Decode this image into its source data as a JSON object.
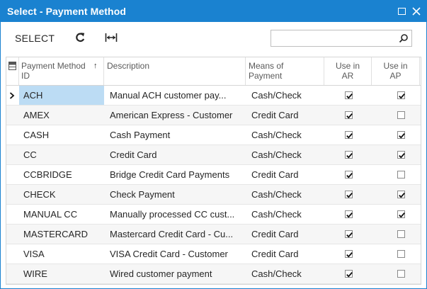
{
  "window": {
    "title": "Select - Payment Method"
  },
  "toolbar": {
    "select_label": "SELECT",
    "refresh_icon": "refresh-icon",
    "fit_icon": "fit-columns-icon"
  },
  "search": {
    "value": "",
    "placeholder": "",
    "icon": "search-icon"
  },
  "grid": {
    "headers": {
      "id": "Payment Method ID",
      "description": "Description",
      "means": "Means of Payment",
      "use_ar": "Use in AR",
      "use_ap": "Use in AP"
    },
    "sort": {
      "column": "id",
      "direction": "asc"
    },
    "rows": [
      {
        "id": "ACH",
        "description": "Manual ACH customer pay...",
        "means": "Cash/Check",
        "use_ar": true,
        "use_ap": true,
        "current": true
      },
      {
        "id": "AMEX",
        "description": "American Express - Customer",
        "means": "Credit Card",
        "use_ar": true,
        "use_ap": false
      },
      {
        "id": "CASH",
        "description": "Cash Payment",
        "means": "Cash/Check",
        "use_ar": true,
        "use_ap": true
      },
      {
        "id": "CC",
        "description": "Credit Card",
        "means": "Cash/Check",
        "use_ar": true,
        "use_ap": true
      },
      {
        "id": "CCBRIDGE",
        "description": "Bridge Credit Card Payments",
        "means": "Credit Card",
        "use_ar": true,
        "use_ap": false
      },
      {
        "id": "CHECK",
        "description": "Check Payment",
        "means": "Cash/Check",
        "use_ar": true,
        "use_ap": true
      },
      {
        "id": "MANUAL CC",
        "description": "Manually processed CC cust...",
        "means": "Cash/Check",
        "use_ar": true,
        "use_ap": true
      },
      {
        "id": "MASTERCARD",
        "description": "Mastercard Credit Card - Cu...",
        "means": "Credit Card",
        "use_ar": true,
        "use_ap": false
      },
      {
        "id": "VISA",
        "description": "VISA Credit Card - Customer",
        "means": "Credit Card",
        "use_ar": true,
        "use_ap": false
      },
      {
        "id": "WIRE",
        "description": "Wired customer payment",
        "means": "Cash/Check",
        "use_ar": true,
        "use_ap": false
      }
    ]
  },
  "colors": {
    "titlebar": "#1a82d0",
    "selected_cell": "#bcdcf4",
    "row_alt": "#f6f6f6"
  }
}
